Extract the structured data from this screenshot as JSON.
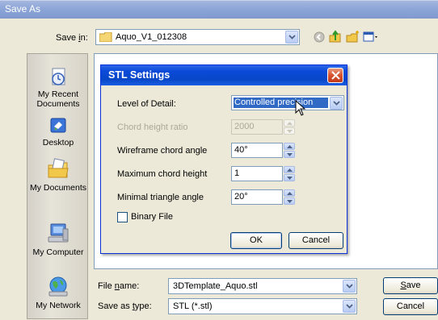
{
  "window": {
    "title": "Save As"
  },
  "save_in": {
    "label_pre": "Save ",
    "label_hotkey": "i",
    "label_post": "n:",
    "value": "Aquo_V1_012308"
  },
  "places": [
    {
      "label": "My Recent Documents",
      "icon": "recent-documents-icon"
    },
    {
      "label": "Desktop",
      "icon": "desktop-icon"
    },
    {
      "label": "My Documents",
      "icon": "my-documents-icon"
    },
    {
      "label": "My Computer",
      "icon": "my-computer-icon"
    },
    {
      "label": "My Network",
      "icon": "my-network-icon"
    }
  ],
  "file_name": {
    "label_pre": "File ",
    "label_hotkey": "n",
    "label_post": "ame:",
    "value": "3DTemplate_Aquo.stl"
  },
  "save_as_type": {
    "label_pre": "Save as ",
    "label_hotkey": "t",
    "label_post": "ype:",
    "value": "STL (*.stl)"
  },
  "buttons": {
    "save_hotkey": "S",
    "save_rest": "ave",
    "cancel": "Cancel"
  },
  "stl_dialog": {
    "title": "STL Settings",
    "level_of_detail_label": "Level of Detail:",
    "level_of_detail_value": "Controlled precision",
    "chord_height_ratio_label": "Chord height ratio",
    "chord_height_ratio_value": "2000",
    "wireframe_chord_angle_label": "Wireframe chord angle",
    "wireframe_chord_angle_value": "40°",
    "max_chord_height_label": "Maximum chord height",
    "max_chord_height_value": "1",
    "min_triangle_angle_label": "Minimal triangle angle",
    "min_triangle_angle_value": "20°",
    "binary_file_label": "Binary File",
    "binary_file_checked": false,
    "ok_label": "OK",
    "cancel_label": "Cancel"
  },
  "colors": {
    "xp_blue": "#0a4ad8",
    "selection": "#316ac5",
    "dialog_bg": "#ece9d8"
  }
}
